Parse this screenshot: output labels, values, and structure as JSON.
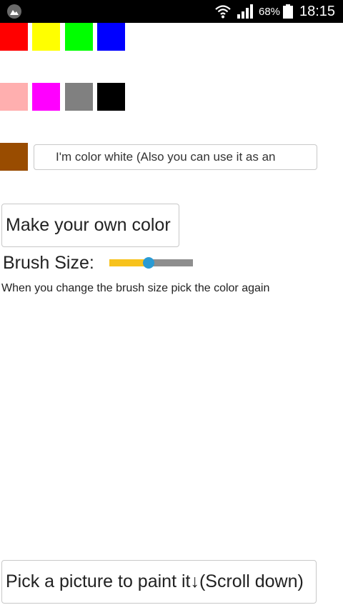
{
  "status_bar": {
    "battery_percent": "68%",
    "time": "18:15",
    "icons": [
      "app-icon",
      "wifi-icon",
      "signal-icon",
      "battery-icon"
    ]
  },
  "swatches": {
    "row1": [
      {
        "name": "red",
        "color": "#ff0000"
      },
      {
        "name": "yellow",
        "color": "#ffff00"
      },
      {
        "name": "green",
        "color": "#00ff00"
      },
      {
        "name": "blue",
        "color": "#0000ff"
      }
    ],
    "row2": [
      {
        "name": "pink",
        "color": "#ffafaf"
      },
      {
        "name": "magenta",
        "color": "#ff00ff"
      },
      {
        "name": "gray",
        "color": "#808080"
      },
      {
        "name": "black",
        "color": "#000000"
      }
    ],
    "row3": [
      {
        "name": "brown",
        "color": "#994c00"
      }
    ]
  },
  "white_button_label": "I'm color white (Also you can use it as an",
  "make_color_button_label": "Make your own color",
  "brush": {
    "label": "Brush Size:",
    "value_fraction": 0.47
  },
  "note": "When you change the brush size pick the color again",
  "pick_picture_button_label": "Pick a picture to paint it↓(Scroll down)"
}
